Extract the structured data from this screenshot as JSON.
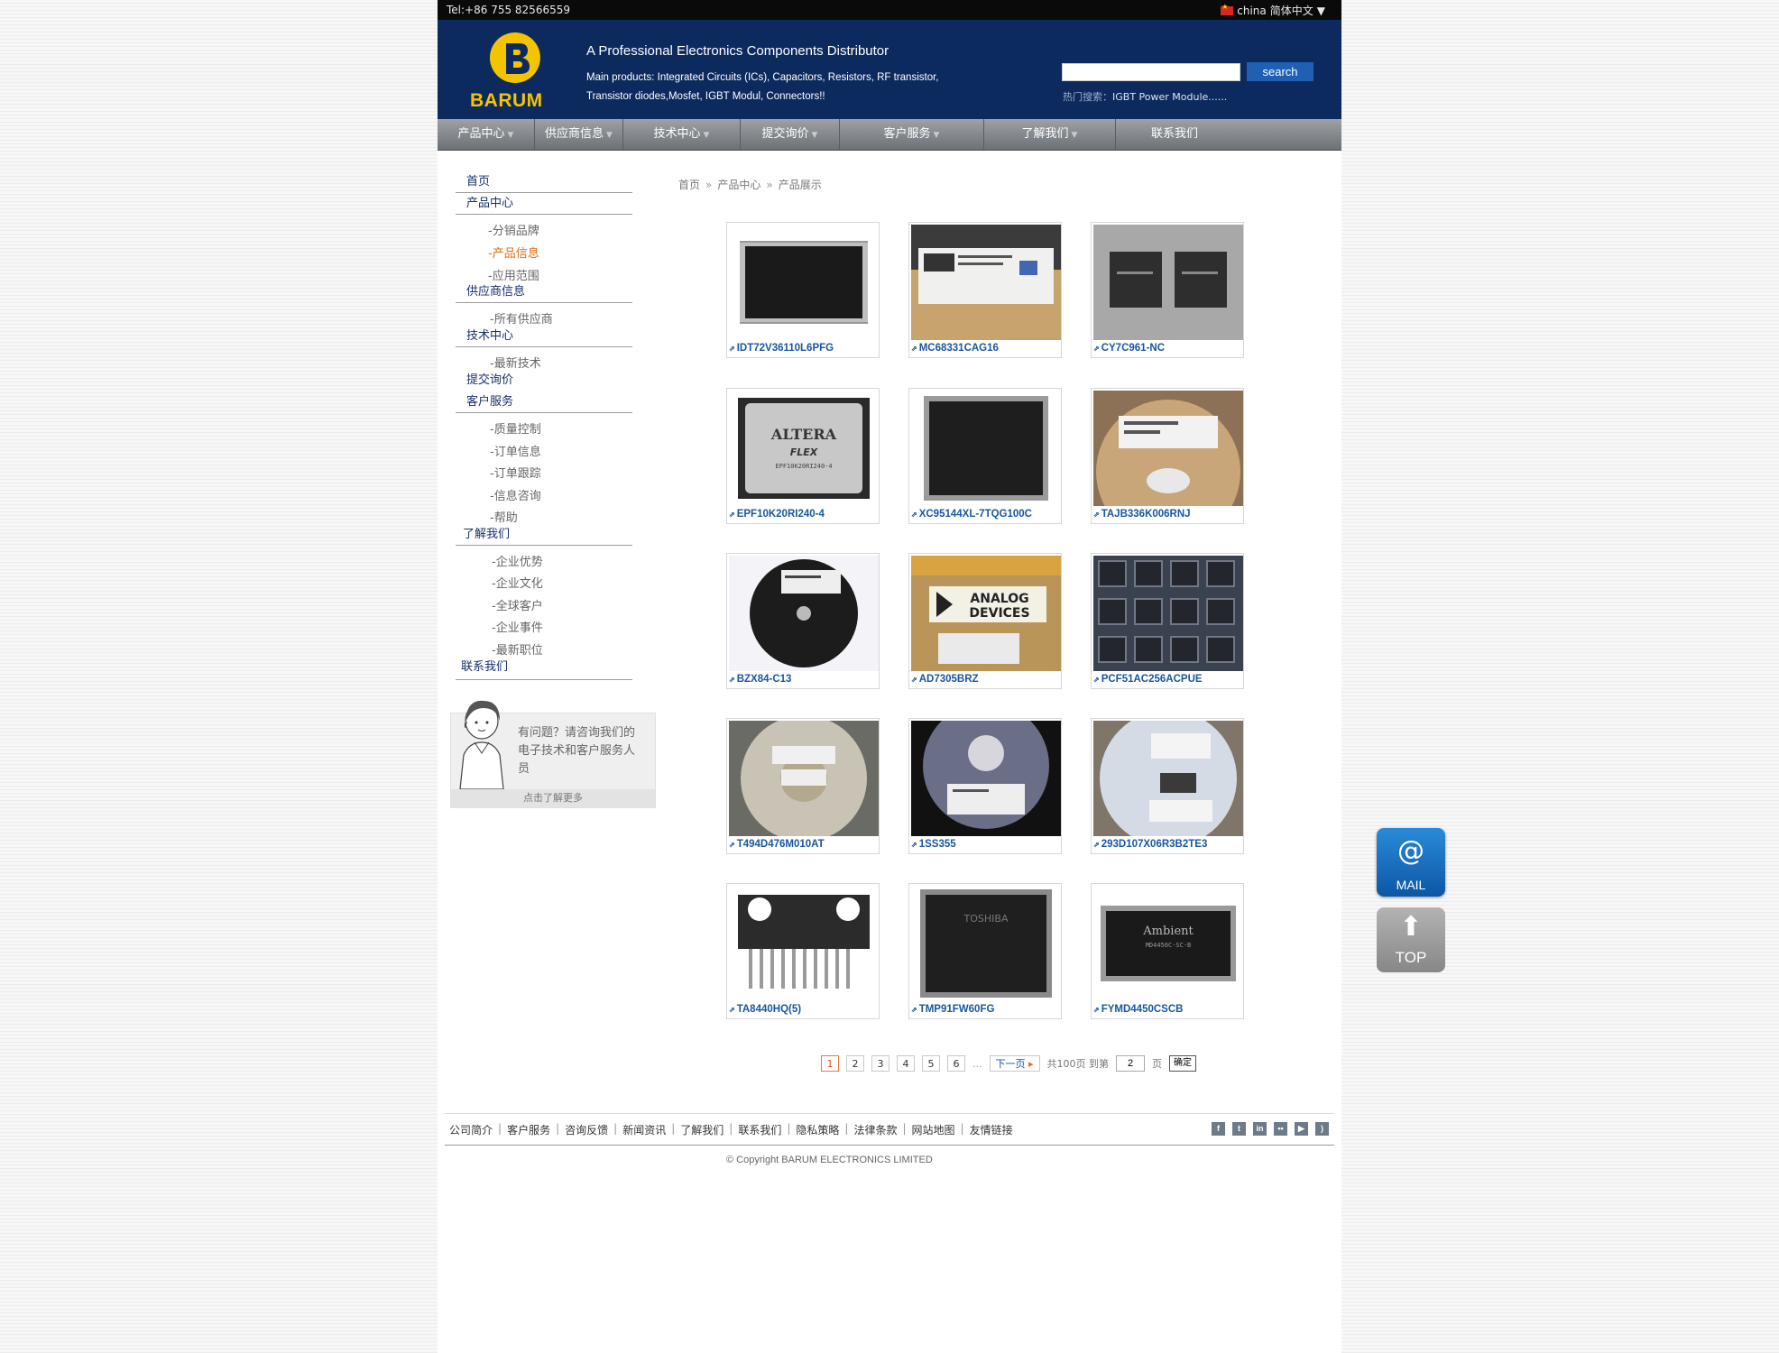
{
  "topbar": {
    "tel": "Tel:+86 755 82566559",
    "lang_region": "china",
    "lang_name": "简体中文"
  },
  "header": {
    "logo_text": "BARUM",
    "tagline": "A Professional Electronics Components Distributor",
    "products": "Main products: Integrated Circuits (ICs), Capacitors, Resistors, RF transistor, Transistor diodes,Mosfet, IGBT Modul, Connectors!!",
    "search_value": "",
    "search_label": "search",
    "hot_label": "热门搜索：",
    "hot_keyword": "IGBT Power Module......"
  },
  "nav": [
    {
      "label": "产品中心",
      "caret": true
    },
    {
      "label": "供应商信息",
      "caret": true
    },
    {
      "label": "技术中心",
      "caret": true
    },
    {
      "label": "提交询价",
      "caret": true
    },
    {
      "label": "客户服务",
      "caret": true
    },
    {
      "label": "了解我们",
      "caret": true
    },
    {
      "label": "联系我们",
      "caret": false
    }
  ],
  "sidebar": {
    "home": "首页",
    "products": "产品中心",
    "products_sub": [
      "-分销品牌",
      "-产品信息",
      "-应用范围"
    ],
    "suppliers": "供应商信息",
    "suppliers_sub": [
      "-所有供应商"
    ],
    "tech": "技术中心",
    "tech_sub": [
      "-最新技术"
    ],
    "inquiry": "提交询价",
    "service": "客户服务",
    "service_sub": [
      "-质量控制",
      "-订单信息",
      "-订单跟踪",
      "-信息咨询",
      "-帮助"
    ],
    "about": "了解我们",
    "about_sub": [
      "-企业优势",
      "-企业文化",
      "-全球客户",
      "-企业事件",
      "-最新职位"
    ],
    "contact": "联系我们"
  },
  "help": {
    "text": "有问题？请咨询我们的电子技术和客户服务人员",
    "more": "点击了解更多"
  },
  "breadcrumb": [
    "首页",
    "产品中心",
    "产品展示"
  ],
  "products": [
    "IDT72V36110L6PFG",
    "MC68331CAG16",
    "CY7C961-NC",
    "EPF10K20RI240-4",
    "XC95144XL-7TQG100C",
    "TAJB336K006RNJ",
    "BZX84-C13",
    "AD7305BRZ",
    "PCF51AC256ACPUE",
    "T494D476M010AT",
    "1SS355",
    "293D107X06R3B2TE3",
    "TA8440HQ(5)",
    "TMP91FW60FG",
    "FYMD4450CSCB"
  ],
  "pager": {
    "pages": [
      "1",
      "2",
      "3",
      "4",
      "5",
      "6"
    ],
    "current": "1",
    "dots": "...",
    "next": "下一页",
    "total": "共100页 到第",
    "goto_value": "2",
    "page_unit": "页",
    "confirm": "确定"
  },
  "footer": {
    "links": [
      "公司简介",
      "客户服务",
      "咨询反馈",
      "新闻资讯",
      "了解我们",
      "联系我们",
      "隐私策略",
      "法律条款",
      "网站地图",
      "友情链接"
    ],
    "copyright": "© Copyright BARUM ELECTRONICS LIMITED"
  },
  "float": {
    "mail": "MAIL",
    "top": "TOP"
  },
  "colors": {
    "header_bg": "#0d2a5f",
    "logo_yellow": "#f5c400",
    "link_blue": "#1a56a0",
    "active_orange": "#e06e0f"
  }
}
